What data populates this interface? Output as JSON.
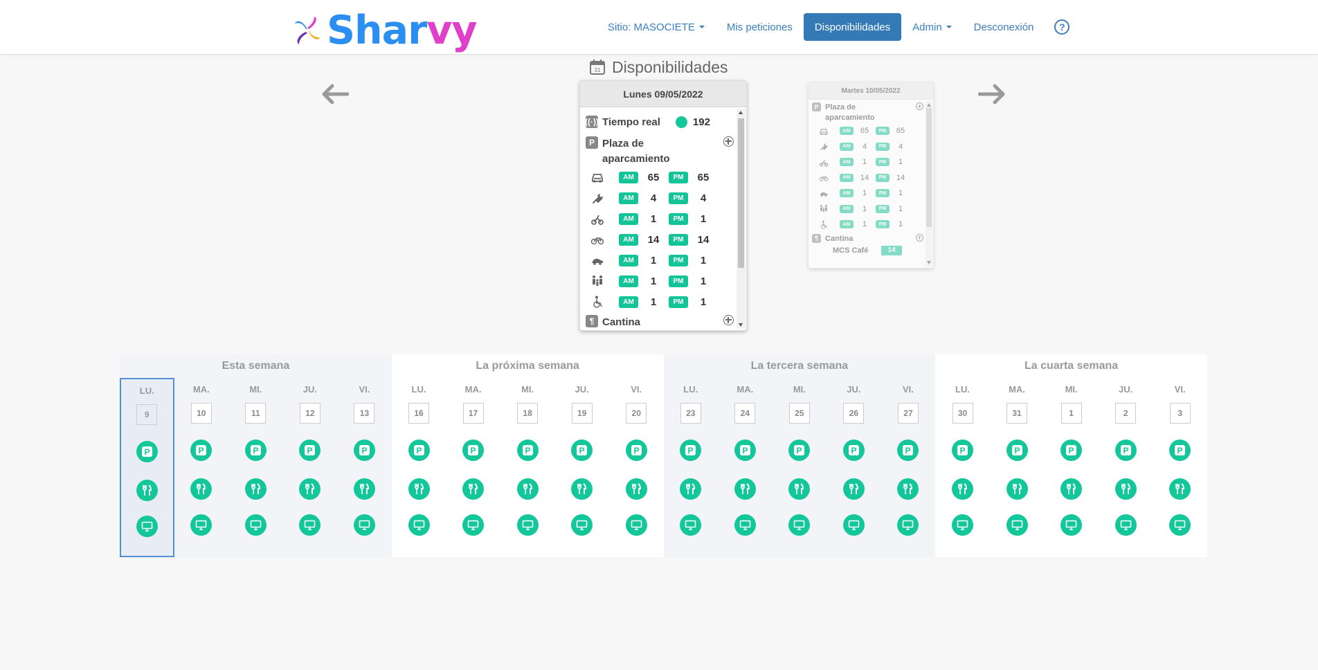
{
  "brand": {
    "part1": "Shar",
    "part2": "vy"
  },
  "nav": {
    "site": "Sitio: MASOCIETE",
    "requests": "Mis peticiones",
    "availability": "Disponibilidades",
    "admin": "Admin",
    "logout": "Desconexión",
    "help": "?"
  },
  "page": {
    "title": "Disponibilidades"
  },
  "main_card": {
    "date": "Lunes 09/05/2022",
    "realtime_label": "Tiempo real",
    "realtime_value": "192",
    "parking_label": "Plaza de aparcamiento",
    "parking_rows": [
      {
        "icon": "car-icon",
        "am_label": "AM",
        "am": "65",
        "pm_label": "PM",
        "pm": "65"
      },
      {
        "icon": "ev-plug-icon",
        "am_label": "AM",
        "am": "4",
        "pm_label": "PM",
        "pm": "4"
      },
      {
        "icon": "moto-icon",
        "am_label": "AM",
        "am": "1",
        "pm_label": "PM",
        "pm": "1"
      },
      {
        "icon": "bicycle-icon",
        "am_label": "AM",
        "am": "14",
        "pm_label": "PM",
        "pm": "14"
      },
      {
        "icon": "small-car-icon",
        "am_label": "AM",
        "am": "1",
        "pm_label": "PM",
        "pm": "1"
      },
      {
        "icon": "family-icon",
        "am_label": "AM",
        "am": "1",
        "pm_label": "PM",
        "pm": "1"
      },
      {
        "icon": "wheelchair-icon",
        "am_label": "AM",
        "am": "1",
        "pm_label": "PM",
        "pm": "1"
      }
    ],
    "cantina_label": "Cantina"
  },
  "side_card": {
    "date": "Martes 10/05/2022",
    "parking_label": "Plaza de aparcamiento",
    "parking_rows": [
      {
        "am_label": "AM",
        "am": "65",
        "pm_label": "PM",
        "pm": "65"
      },
      {
        "am_label": "AM",
        "am": "4",
        "pm_label": "PM",
        "pm": "4"
      },
      {
        "am_label": "AM",
        "am": "1",
        "pm_label": "PM",
        "pm": "1"
      },
      {
        "am_label": "AM",
        "am": "14",
        "pm_label": "PM",
        "pm": "14"
      },
      {
        "am_label": "AM",
        "am": "1",
        "pm_label": "PM",
        "pm": "1"
      },
      {
        "am_label": "AM",
        "am": "1",
        "pm_label": "PM",
        "pm": "1"
      },
      {
        "am_label": "AM",
        "am": "1",
        "pm_label": "PM",
        "pm": "1"
      }
    ],
    "cantina_label": "Cantina",
    "cantina_name": "MCS Café",
    "cantina_value": "14"
  },
  "weeks": [
    {
      "title": "Esta semana",
      "days": [
        {
          "name": "LU.",
          "num": "9",
          "selected": true
        },
        {
          "name": "MA.",
          "num": "10"
        },
        {
          "name": "MI.",
          "num": "11"
        },
        {
          "name": "JU.",
          "num": "12"
        },
        {
          "name": "VI.",
          "num": "13"
        }
      ]
    },
    {
      "title": "La próxima semana",
      "days": [
        {
          "name": "LU.",
          "num": "16"
        },
        {
          "name": "MA.",
          "num": "17"
        },
        {
          "name": "MI.",
          "num": "18"
        },
        {
          "name": "JU.",
          "num": "19"
        },
        {
          "name": "VI.",
          "num": "20"
        }
      ]
    },
    {
      "title": "La tercera semana",
      "days": [
        {
          "name": "LU.",
          "num": "23"
        },
        {
          "name": "MA.",
          "num": "24"
        },
        {
          "name": "MI.",
          "num": "25"
        },
        {
          "name": "JU.",
          "num": "26"
        },
        {
          "name": "VI.",
          "num": "27"
        }
      ]
    },
    {
      "title": "La cuarta semana",
      "days": [
        {
          "name": "LU.",
          "num": "30"
        },
        {
          "name": "MA.",
          "num": "31"
        },
        {
          "name": "MI.",
          "num": "1"
        },
        {
          "name": "JU.",
          "num": "2"
        },
        {
          "name": "VI.",
          "num": "3"
        }
      ]
    }
  ],
  "colors": {
    "accent": "#14c79a",
    "nav_active": "#337ab7",
    "link": "#3a7ec2",
    "logo_blue": "#2b8ef1",
    "logo_pink": "#e040c9"
  }
}
